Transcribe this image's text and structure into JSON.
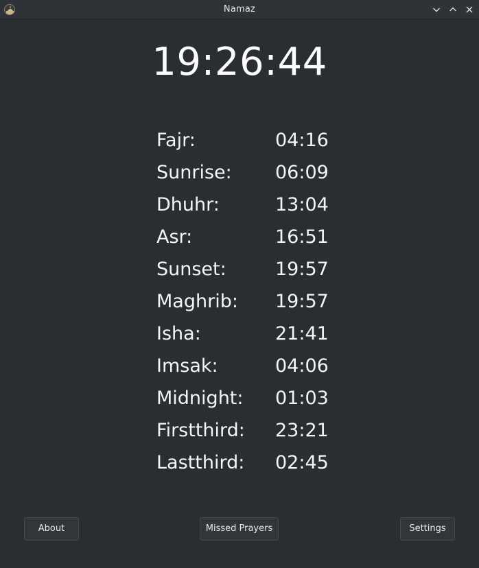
{
  "window": {
    "title": "Namaz",
    "app_icon": "mosque-icon"
  },
  "clock": {
    "time": "19:26:44"
  },
  "prayer_times": [
    {
      "name": "Fajr:",
      "time": "04:16"
    },
    {
      "name": "Sunrise:",
      "time": "06:09"
    },
    {
      "name": "Dhuhr:",
      "time": "13:04"
    },
    {
      "name": "Asr:",
      "time": "16:51"
    },
    {
      "name": "Sunset:",
      "time": "19:57"
    },
    {
      "name": "Maghrib:",
      "time": "19:57"
    },
    {
      "name": "Isha:",
      "time": "21:41"
    },
    {
      "name": "Imsak:",
      "time": "04:06"
    },
    {
      "name": "Midnight:",
      "time": "01:03"
    },
    {
      "name": "Firstthird:",
      "time": "23:21"
    },
    {
      "name": "Lastthird:",
      "time": "02:45"
    }
  ],
  "buttons": {
    "about": "About",
    "missed_prayers": "Missed Prayers",
    "settings": "Settings"
  },
  "colors": {
    "background": "#2a2e32",
    "titlebar": "#2f3338",
    "button": "#31363b"
  }
}
